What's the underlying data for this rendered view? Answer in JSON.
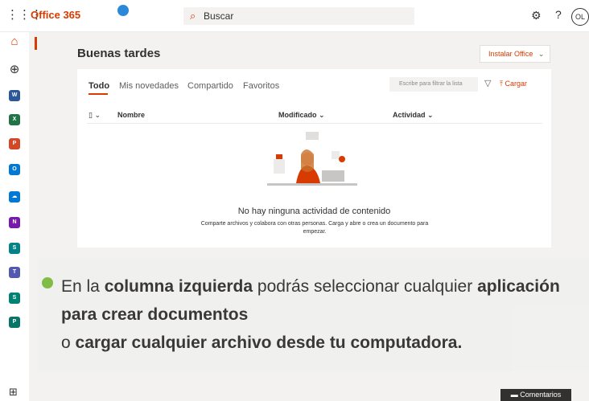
{
  "topbar": {
    "brand": "Office 365",
    "search_placeholder": "Buscar",
    "avatar_initials": "OL"
  },
  "rail": {
    "apps": [
      {
        "name": "home",
        "color": "#d83b01",
        "glyph": "⌂"
      },
      {
        "name": "create",
        "color": "#323130",
        "glyph": "⊕"
      },
      {
        "name": "word",
        "color": "#2b579a",
        "glyph": "W"
      },
      {
        "name": "excel",
        "color": "#217346",
        "glyph": "X"
      },
      {
        "name": "powerpoint",
        "color": "#d24726",
        "glyph": "P"
      },
      {
        "name": "outlook",
        "color": "#0078d4",
        "glyph": "O"
      },
      {
        "name": "onedrive",
        "color": "#0078d4",
        "glyph": "☁"
      },
      {
        "name": "onenote",
        "color": "#7719aa",
        "glyph": "N"
      },
      {
        "name": "sharepoint",
        "color": "#038387",
        "glyph": "S"
      },
      {
        "name": "teams",
        "color": "#5558af",
        "glyph": "T"
      },
      {
        "name": "sway",
        "color": "#008272",
        "glyph": "S"
      },
      {
        "name": "planner",
        "color": "#077568",
        "glyph": "P"
      }
    ]
  },
  "main": {
    "greeting": "Buenas tardes",
    "install_label": "Instalar Office",
    "tabs": [
      "Todo",
      "Mis novedades",
      "Compartido",
      "Favoritos"
    ],
    "filter_placeholder": "Escribe para filtrar la lista",
    "upload_label": "Cargar",
    "columns": {
      "name": "Nombre",
      "modified": "Modificado",
      "activity": "Actividad"
    },
    "empty_title": "No hay ninguna actividad de contenido",
    "empty_subtitle": "Comparte archivos y colabora con otras personas. Carga y abre o crea un documento para empezar."
  },
  "overlay": {
    "t1": "En la ",
    "b1": "columna izquierda",
    "t2": " podrás seleccionar cualquier ",
    "b2": "aplicación para crear documentos",
    "t3": " o ",
    "b3": "cargar cualquier archivo desde tu computadora."
  },
  "footer": {
    "feedback_label": "Comentarios"
  },
  "colors": {
    "accent": "#d83b01",
    "bullet": "#7dbb3d"
  }
}
